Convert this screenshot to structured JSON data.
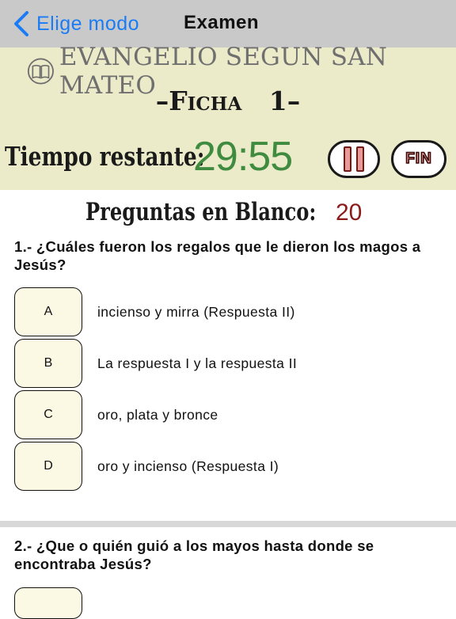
{
  "nav": {
    "back_label": "Elige modo",
    "title": "Examen"
  },
  "header": {
    "book_title": "EVANGELIO SEGUN SAN MATEO",
    "ficha_dash_left": "–",
    "ficha_label": "Ficha",
    "ficha_number": "1",
    "ficha_dash_right": "–",
    "timer_label": "Tiempo restante:",
    "timer_value": "29:55",
    "fin_label": "FIN"
  },
  "blank": {
    "label": "Preguntas en Blanco:",
    "count": "20"
  },
  "questions": [
    {
      "text": "1.- ¿Cuáles fueron los regalos que le dieron los magos a Jesús?",
      "options": [
        {
          "letter": "A",
          "text": "incienso y mirra (Respuesta II)"
        },
        {
          "letter": "B",
          "text": "La respuesta I y la respuesta II"
        },
        {
          "letter": "C",
          "text": "oro, plata y bronce"
        },
        {
          "letter": "D",
          "text": "oro y incienso (Respuesta I)"
        }
      ]
    },
    {
      "text": "2.- ¿Que o quién guió a los mayos hasta donde se encontraba Jesús?"
    }
  ],
  "colors": {
    "accent": "#1a7cf5",
    "header_bg": "#ecebc9",
    "timer": "#3f8b3f",
    "blank_count": "#8b1a1a",
    "option_bg": "#fbf8e4"
  },
  "icons": {
    "back": "chevron-left-icon",
    "book": "book-icon",
    "pause": "pause-icon"
  }
}
